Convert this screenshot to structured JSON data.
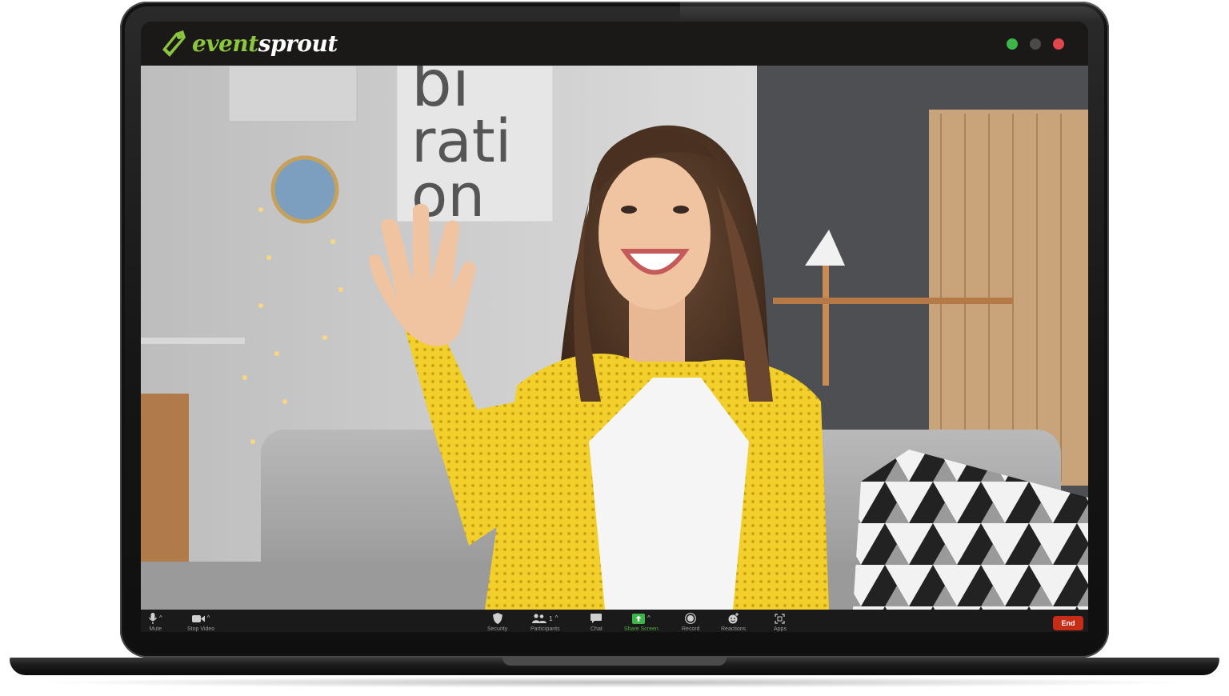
{
  "app": {
    "brand_part1": "event",
    "brand_part2": "sprout",
    "brand_color": "#8cc63f"
  },
  "window_controls": [
    {
      "name": "maximize",
      "color": "#3cb649"
    },
    {
      "name": "minimize",
      "color": "#4a4a4a"
    },
    {
      "name": "close",
      "color": "#e0474c"
    }
  ],
  "video": {
    "wall_text": [
      "bi",
      "rati",
      "on"
    ],
    "subject": "participant-video"
  },
  "toolbar": {
    "mute": {
      "label": "Mute",
      "icon": "microphone-icon"
    },
    "video": {
      "label": "Stop Video",
      "icon": "video-camera-icon"
    },
    "security": {
      "label": "Security",
      "icon": "shield-icon"
    },
    "participants": {
      "label": "Participants",
      "icon": "people-icon",
      "count": "1"
    },
    "chat": {
      "label": "Chat",
      "icon": "chat-bubble-icon"
    },
    "share": {
      "label": "Share Screen",
      "icon": "share-screen-icon",
      "accent": "#3cb649"
    },
    "record": {
      "label": "Record",
      "icon": "record-icon"
    },
    "reactions": {
      "label": "Reactions",
      "icon": "smiley-icon"
    },
    "apps": {
      "label": "Apps",
      "icon": "apps-icon"
    },
    "end": {
      "label": "End",
      "color": "#c72c17"
    }
  }
}
